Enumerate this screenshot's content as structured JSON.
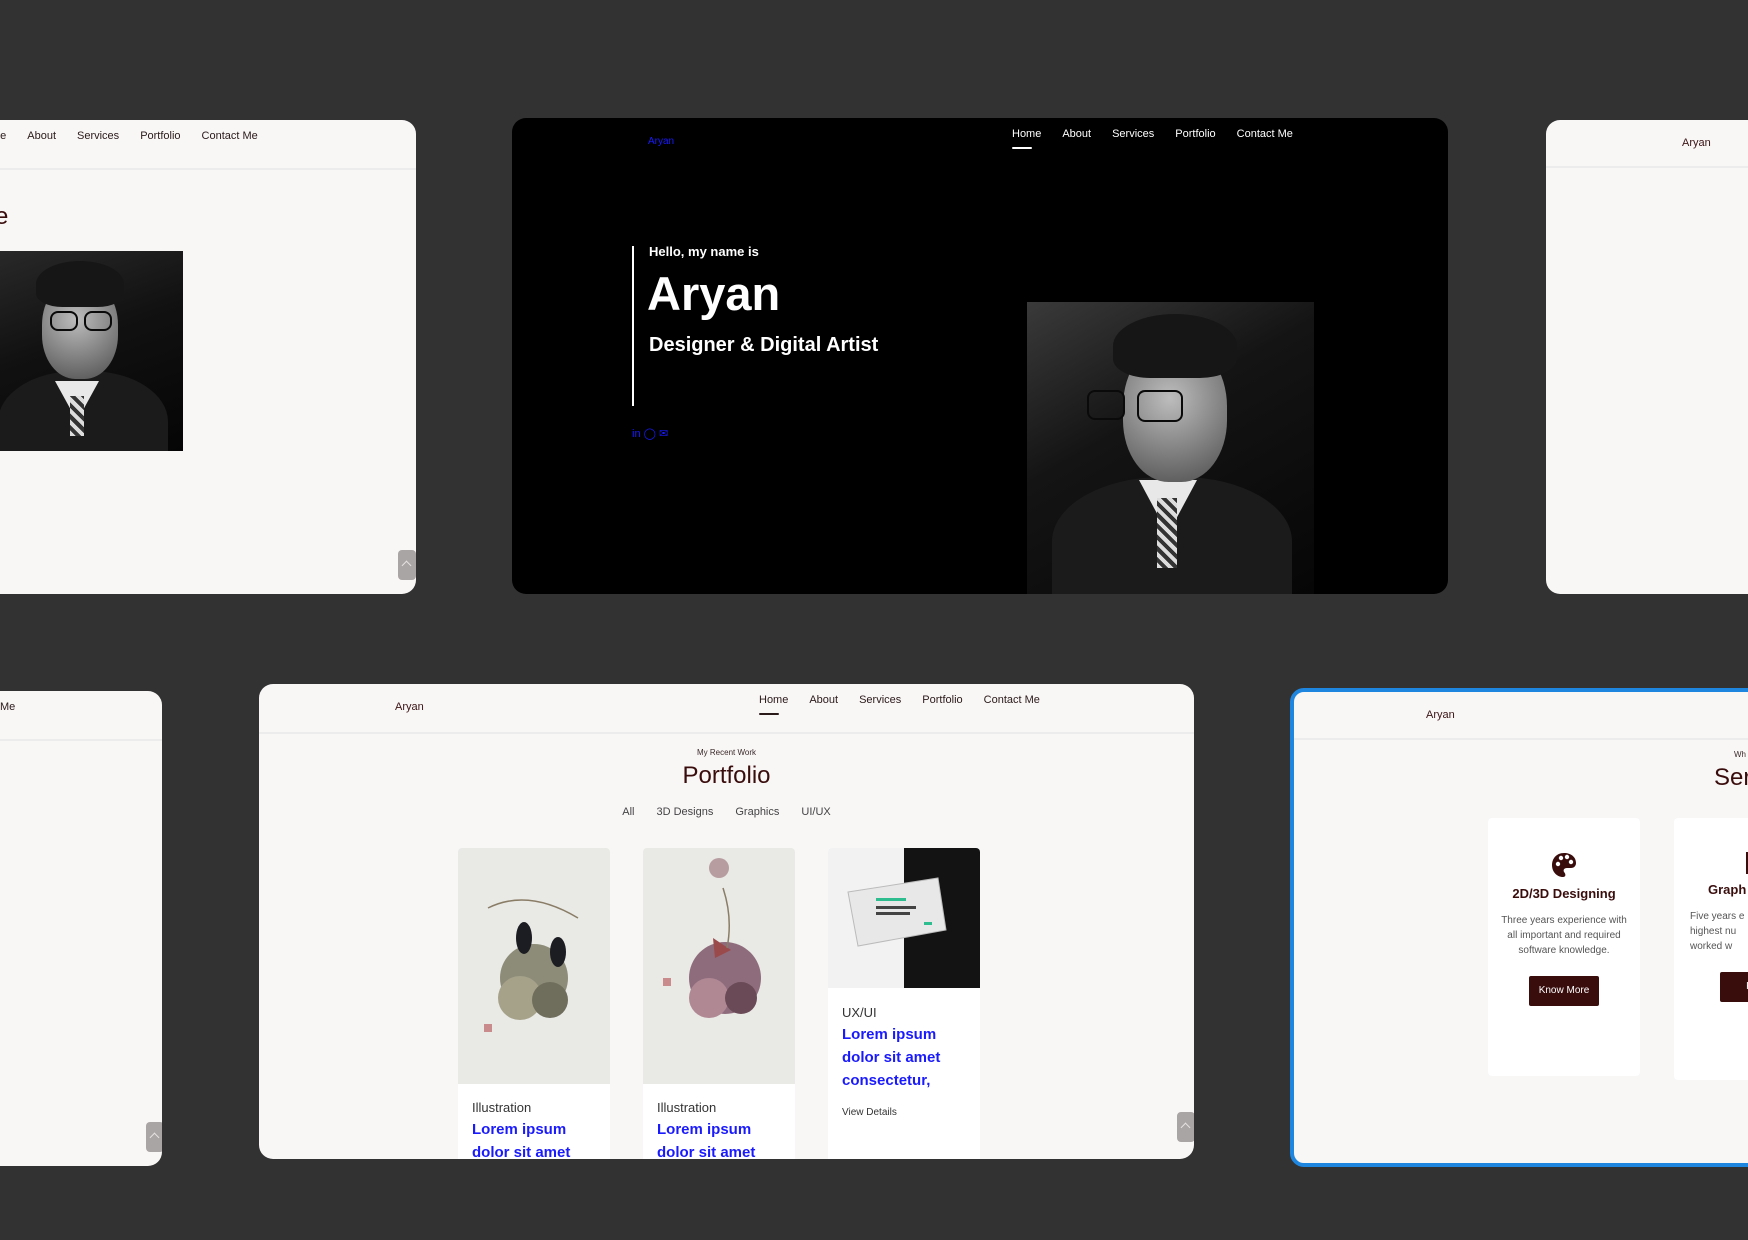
{
  "nav": {
    "logo": "Aryan",
    "items": [
      "Home",
      "About",
      "Services",
      "Portfolio",
      "Contact Me"
    ],
    "items_left_cut": [
      "ne",
      "About",
      "Services",
      "Portfolio",
      "Contact Me"
    ],
    "bottom_left_cut": "Me"
  },
  "about_cut": {
    "heading_fragment": "e"
  },
  "hero": {
    "greeting": "Hello, my name is",
    "name": "Aryan",
    "role": "Designer & Digital Artist",
    "social": "in ◯ ✉"
  },
  "portfolio": {
    "kicker": "My Recent Work",
    "title": "Portfolio",
    "filters": [
      "All",
      "3D Designs",
      "Graphics",
      "UI/UX"
    ],
    "items": [
      {
        "category": "Illustration",
        "title": "Lorem ipsum dolor sit amet"
      },
      {
        "category": "Illustration",
        "title": "Lorem ipsum dolor sit amet"
      },
      {
        "category": "UX/UI",
        "title": "Lorem ipsum dolor sit amet consectetur,",
        "action": "View Details"
      }
    ]
  },
  "services": {
    "kicker": "Wh",
    "title": "Ser",
    "cards": [
      {
        "title": "2D/3D Designing",
        "text": "Three years experience with all important and required software knowledge.",
        "button": "Know More"
      },
      {
        "title": "Graph",
        "text": "Five years e highest nu worked w",
        "button": "Kno"
      }
    ]
  },
  "colors": {
    "background": "#323232",
    "page": "#f9f6f6",
    "accent": "#3a0d0d",
    "link": "#1a1aff",
    "selection": "#1f86e0"
  }
}
